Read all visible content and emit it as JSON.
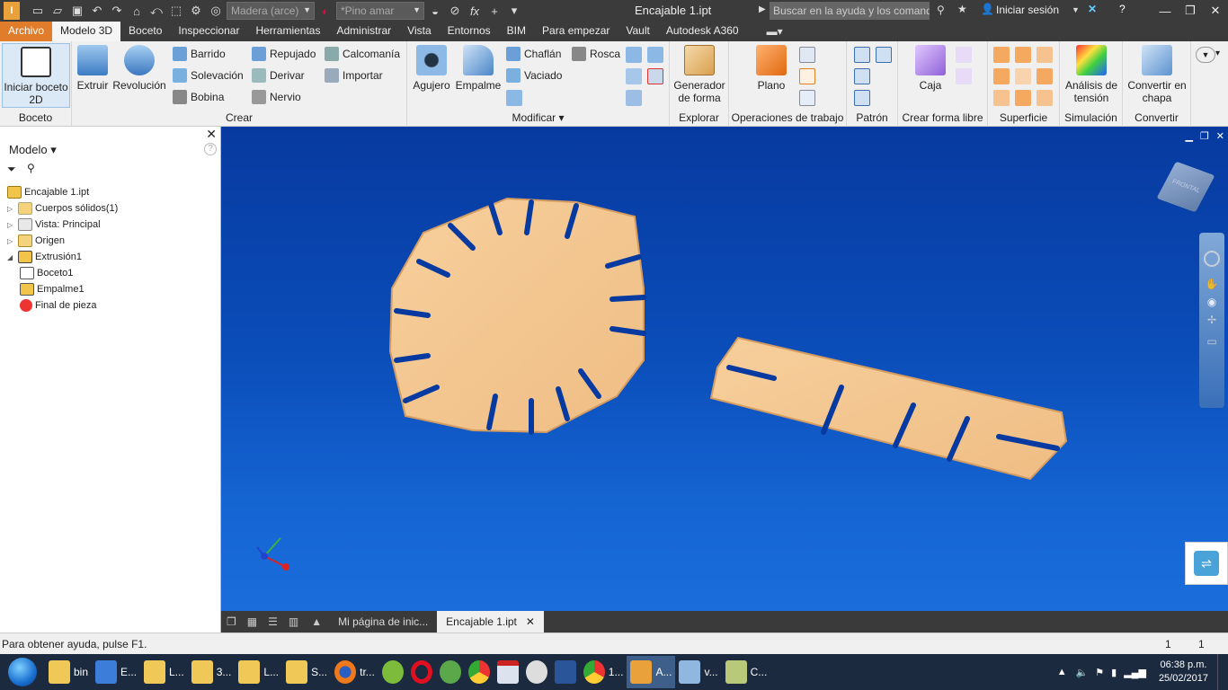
{
  "window": {
    "title": "Encajable 1.ipt",
    "search_placeholder": "Buscar en la ayuda y los comand",
    "signin": "Iniciar sesión"
  },
  "quickaccess": {
    "material": "Madera (arce)",
    "appearance": "*Pino amar"
  },
  "tabs": [
    "Archivo",
    "Modelo 3D",
    "Boceto",
    "Inspeccionar",
    "Herramientas",
    "Administrar",
    "Vista",
    "Entornos",
    "BIM",
    "Para empezar",
    "Vault",
    "Autodesk A360"
  ],
  "ribbon": {
    "boceto": {
      "title": "Boceto",
      "start": "Iniciar boceto 2D"
    },
    "crear": {
      "title": "Crear",
      "extruir": "Extruir",
      "revolucion": "Revolución",
      "barrido": "Barrido",
      "solevacion": "Solevación",
      "bobina": "Bobina",
      "repujado": "Repujado",
      "derivar": "Derivar",
      "nervio": "Nervio",
      "calcomania": "Calcomanía",
      "importar": "Importar"
    },
    "modificar": {
      "title": "Modificar",
      "agujero": "Agujero",
      "empalme": "Empalme",
      "chaflan": "Chaflán",
      "vaciado": "Vaciado",
      "rosca": "Rosca"
    },
    "explorar": {
      "title": "Explorar",
      "generador": "Generador de forma"
    },
    "operaciones": {
      "title": "Operaciones de trabajo",
      "plano": "Plano"
    },
    "patron": {
      "title": "Patrón"
    },
    "forma_libre": {
      "title": "Crear forma libre",
      "caja": "Caja"
    },
    "superficie": {
      "title": "Superficie"
    },
    "simulacion": {
      "title": "Simulación",
      "analisis": "Análisis de tensión"
    },
    "convertir": {
      "title": "Convertir",
      "chapa": "Convertir en chapa"
    }
  },
  "browser": {
    "title": "Modelo",
    "nodes": [
      "Encajable 1.ipt",
      "Cuerpos sólidos(1)",
      "Vista: Principal",
      "Origen",
      "Extrusión1",
      "Boceto1",
      "Empalme1",
      "Final de pieza"
    ]
  },
  "viewcube": {
    "label": "FRONTAL"
  },
  "doc_tabs": [
    "Mi página de inic...",
    "Encajable 1.ipt"
  ],
  "status": {
    "help": "Para obtener ayuda, pulse F1.",
    "a": "1",
    "b": "1"
  },
  "taskbar": {
    "items": [
      "bin",
      "E...",
      "L...",
      "3...",
      "L...",
      "S...",
      "tr...",
      "1...",
      "A...",
      "v...",
      "C..."
    ],
    "time": "06:38 p.m.",
    "date": "25/02/2017"
  },
  "colors": {
    "accent": "#e07c2a",
    "viewport_top": "#073aa0",
    "viewport_bottom": "#1a6ddb",
    "part": "#f3c48e"
  }
}
